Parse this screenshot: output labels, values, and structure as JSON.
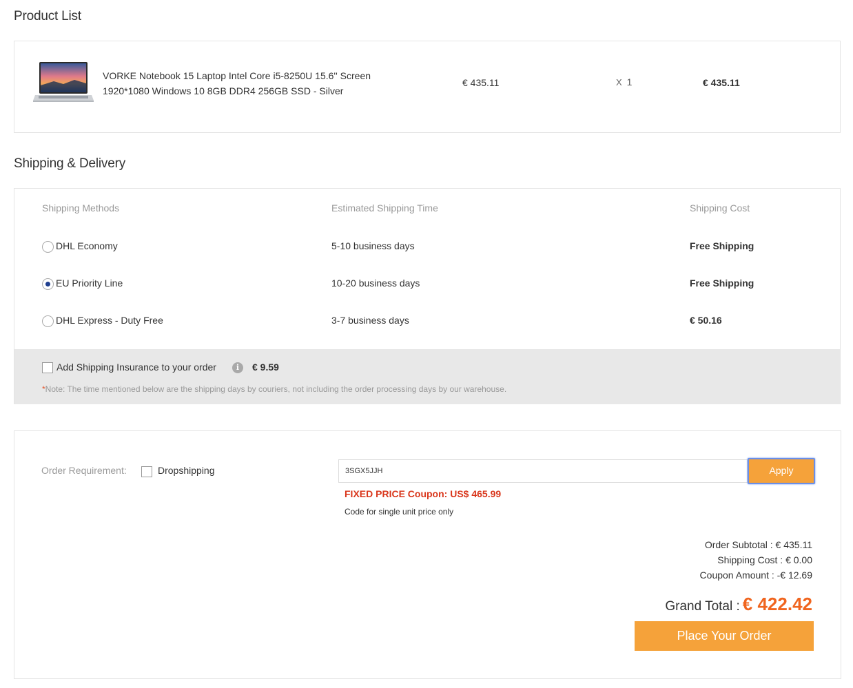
{
  "product_list": {
    "title": "Product List",
    "items": [
      {
        "name": "VORKE Notebook 15 Laptop Intel Core i5-8250U 15.6'' Screen 1920*1080 Windows 10 8GB DDR4 256GB SSD - Silver",
        "unit_price": "€ 435.11",
        "qty_prefix": "X",
        "qty": "1",
        "total": "€ 435.11"
      }
    ]
  },
  "shipping": {
    "title": "Shipping & Delivery",
    "headers": {
      "method": "Shipping Methods",
      "time": "Estimated Shipping Time",
      "cost": "Shipping Cost"
    },
    "methods": [
      {
        "name": "DHL Economy",
        "time": "5-10 business days",
        "cost": "Free Shipping",
        "selected": false
      },
      {
        "name": "EU Priority Line",
        "time": "10-20 business days",
        "cost": "Free Shipping",
        "selected": true
      },
      {
        "name": "DHL Express - Duty Free",
        "time": "3-7 business days",
        "cost": "€ 50.16",
        "selected": false
      }
    ],
    "insurance": {
      "label": "Add Shipping Insurance to your order",
      "info_glyph": "i",
      "price": "€ 9.59",
      "checked": false
    },
    "note_star": "*",
    "note": "Note: The time mentioned below are the shipping days by couriers, not including the order processing days by our warehouse."
  },
  "order": {
    "requirement_label": "Order Requirement:",
    "dropshipping_label": "Dropshipping",
    "coupon_code": "3SGX5JJH",
    "apply_label": "Apply",
    "coupon_message": "FIXED PRICE Coupon: US$ 465.99",
    "coupon_sub": "Code for single unit price only",
    "subtotal": "Order Subtotal : € 435.11",
    "shipping_cost": "Shipping Cost : € 0.00",
    "coupon_amount": "Coupon Amount : -€ 12.69",
    "grand_total_label": "Grand Total :",
    "grand_total_value": "€ 422.42",
    "place_order_label": "Place Your Order"
  },
  "colors": {
    "accent_orange": "#f5a23a",
    "grand_total": "#f0651f",
    "coupon_red": "#d9361b",
    "radio_selected": "#1f3f8f"
  }
}
